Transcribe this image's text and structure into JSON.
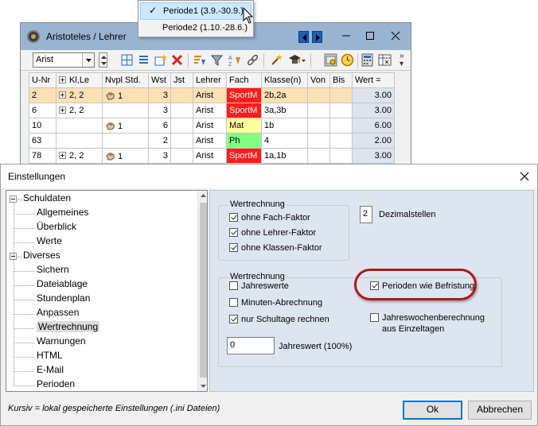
{
  "period_menu": {
    "items": [
      {
        "label": "Periode1 (3.9.-30.9.)",
        "checked": true
      },
      {
        "label": "Periode2 (1.10.-28.6.)",
        "checked": false
      }
    ]
  },
  "main_window": {
    "title": "Aristoteles / Lehrer",
    "teacher_select": {
      "value": "Arist"
    },
    "toolbar_icons": [
      "grid-add-icon",
      "list-icon",
      "new-row-icon",
      "delete-icon",
      "sort-icon",
      "filter-icon",
      "sort-az-icon",
      "link-icon",
      "wizard-icon",
      "graduate-icon",
      "settings-icon",
      "clock-icon",
      "calculator-icon",
      "table-settings-icon"
    ],
    "grid": {
      "columns": [
        "U-Nr",
        "Kl,Le",
        "Nvpl Std.",
        "Wst",
        "Jst",
        "Lehrer",
        "Fach",
        "Klasse(n)",
        "Von",
        "Bis",
        "Wert ="
      ],
      "rows": [
        {
          "u_nr": "2",
          "kl_le": "2, 2",
          "has_plus": true,
          "nvpl": "1",
          "has_hand": true,
          "wst": "3",
          "jst": "",
          "lehrer": "Arist",
          "fach": "SportM",
          "fach_color": "#ff1a1a",
          "fach_text_color": "#ffffff",
          "klassen": "2b,2a",
          "von": "",
          "bis": "",
          "wert": "3.00",
          "selected": true
        },
        {
          "u_nr": "6",
          "kl_le": "2, 2",
          "has_plus": true,
          "nvpl": "",
          "has_hand": false,
          "wst": "3",
          "jst": "",
          "lehrer": "Arist",
          "fach": "SportM",
          "fach_color": "#ff1a1a",
          "fach_text_color": "#ffffff",
          "klassen": "3a,3b",
          "von": "",
          "bis": "",
          "wert": "3.00",
          "selected": false
        },
        {
          "u_nr": "10",
          "kl_le": "",
          "has_plus": false,
          "nvpl": "1",
          "has_hand": true,
          "wst": "6",
          "jst": "",
          "lehrer": "Arist",
          "fach": "Mat",
          "fach_color": "#ffff99",
          "fach_text_color": "#000000",
          "klassen": "1b",
          "von": "",
          "bis": "",
          "wert": "6.00",
          "selected": false
        },
        {
          "u_nr": "63",
          "kl_le": "",
          "has_plus": false,
          "nvpl": "",
          "has_hand": false,
          "wst": "2",
          "jst": "",
          "lehrer": "Arist",
          "fach": "Ph",
          "fach_color": "#80ff80",
          "fach_text_color": "#000000",
          "klassen": "4",
          "von": "",
          "bis": "",
          "wert": "2.00",
          "selected": false
        },
        {
          "u_nr": "78",
          "kl_le": "2, 2",
          "has_plus": true,
          "nvpl": "1",
          "has_hand": true,
          "wst": "3",
          "jst": "",
          "lehrer": "Arist",
          "fach": "SportM",
          "fach_color": "#ff1a1a",
          "fach_text_color": "#ffffff",
          "klassen": "1a,1b",
          "von": "",
          "bis": "",
          "wert": "3.00",
          "selected": false
        }
      ]
    }
  },
  "dialog": {
    "title": "Einstellungen",
    "tree": {
      "items": [
        {
          "label": "Schuldaten",
          "level": 0,
          "expanded": true
        },
        {
          "label": "Allgemeines",
          "level": 1
        },
        {
          "label": "Überblick",
          "level": 1
        },
        {
          "label": "Werte",
          "level": 1
        },
        {
          "label": "Diverses",
          "level": 0,
          "expanded": true
        },
        {
          "label": "Sichern",
          "level": 1
        },
        {
          "label": "Dateiablage",
          "level": 1
        },
        {
          "label": "Stundenplan",
          "level": 1
        },
        {
          "label": "Anpassen",
          "level": 1
        },
        {
          "label": "Wertrechnung",
          "level": 1,
          "selected": true
        },
        {
          "label": "Warnungen",
          "level": 1
        },
        {
          "label": "HTML",
          "level": 1
        },
        {
          "label": "E-Mail",
          "level": 1
        },
        {
          "label": "Perioden",
          "level": 1
        }
      ]
    },
    "group1": {
      "title": "Wertrechnung",
      "options": [
        {
          "label": "ohne Fach-Faktor",
          "checked": true
        },
        {
          "label": "ohne Lehrer-Faktor",
          "checked": true
        },
        {
          "label": "ohne Klassen-Faktor",
          "checked": true
        }
      ]
    },
    "decimals": {
      "value": "2",
      "label": "Dezimalstellen"
    },
    "group2": {
      "title": "Wertrechnung",
      "jahreswerte": {
        "label": "Jahreswerte",
        "checked": false
      },
      "minuten": {
        "label": "Minuten-Abrechnung",
        "checked": false
      },
      "schultage": {
        "label": "nur Schultage rechnen",
        "checked": true
      },
      "perioden": {
        "label": "Perioden wie Befristung",
        "checked": true
      },
      "jahreswochen": {
        "label_line1": "Jahreswochenberechnung",
        "label_line2": "aus Einzeltagen",
        "checked": false
      },
      "jahreswert": {
        "value": "0",
        "label": "Jahreswert (100%)"
      }
    },
    "footer_note": "Kursiv = lokal gespeicherte Einstellungen (.ini Dateien)",
    "ok_label": "Ok",
    "cancel_label": "Abbrechen",
    "highlight_color": "#b4161b"
  }
}
